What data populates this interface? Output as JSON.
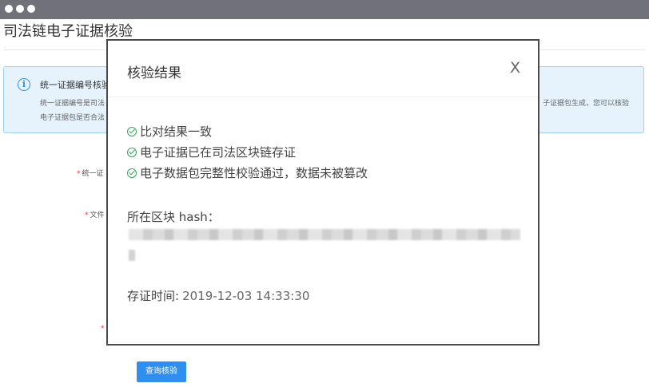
{
  "window": {
    "dots": 3
  },
  "page": {
    "title": "司法链电子证据核验"
  },
  "info": {
    "icon": "info-icon",
    "title": "统一证据编号核验",
    "line1": "统一证据编号是司法",
    "line2": "电子证据包是否合法",
    "line1_right": "子证据包生成，您可以核验"
  },
  "form": {
    "label_evidence_no": "统一证",
    "label_file": "文件",
    "required_mark": "*",
    "query_button": "查询核验"
  },
  "modal": {
    "title": "核验结果",
    "close": "X",
    "results": [
      "比对结果一致",
      "电子证据已在司法区块链存证",
      "电子数据包完整性校验通过，数据未被篡改"
    ],
    "hash_label": "所在区块 hash：",
    "time_label": "存证时间:",
    "time_value": "2019-12-03 14:33:30"
  },
  "colors": {
    "titlebar": "#717179",
    "accent": "#2f8ff0",
    "success": "#3aa55e",
    "info_bg": "#e6f3fc",
    "required": "#e53935"
  }
}
